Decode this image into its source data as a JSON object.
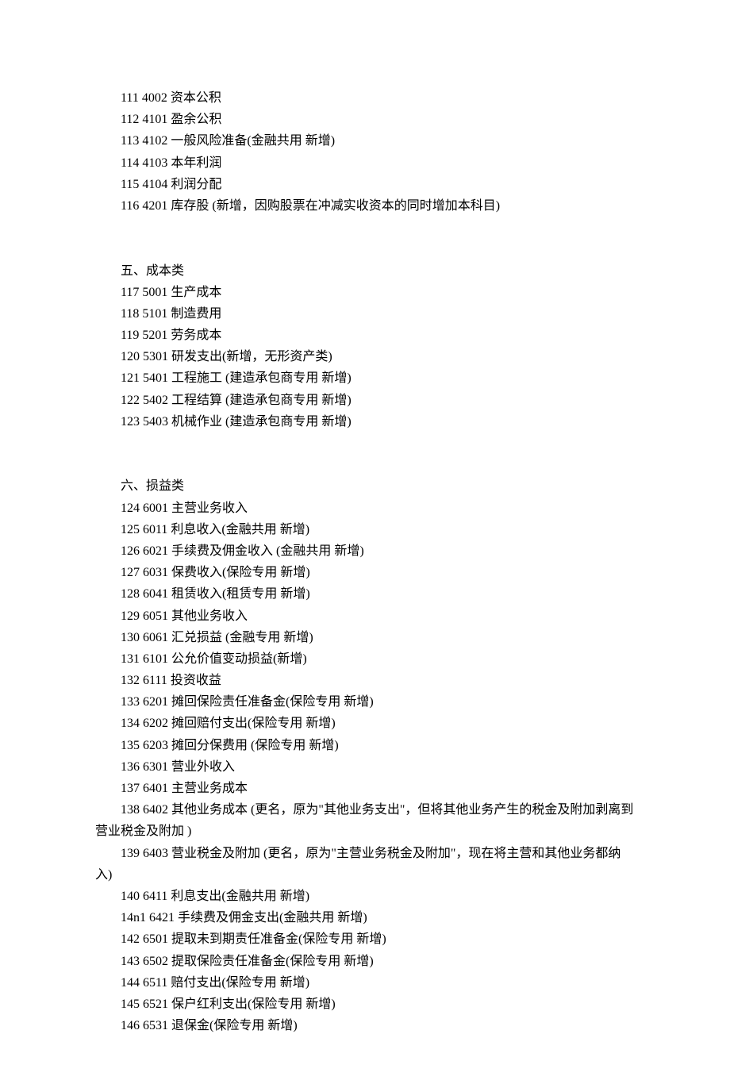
{
  "group1": [
    "111 4002  资本公积",
    "112 4101  盈余公积",
    "113 4102  一般风险准备(金融共用  新增)",
    "114 4103  本年利润",
    "115 4104  利润分配",
    "116 4201  库存股          (新增，因购股票在冲减实收资本的同时增加本科目)"
  ],
  "section5": {
    "heading": "五、成本类",
    "lines": [
      "117 5001  生产成本",
      "118 5101  制造费用",
      "119 5201  劳务成本",
      "120 5301  研发支出(新增，无形资产类)",
      "121 5401  工程施工  (建造承包商专用  新增)",
      "122 5402  工程结算  (建造承包商专用  新增)",
      "123 5403  机械作业  (建造承包商专用  新增)"
    ]
  },
  "section6": {
    "heading": "六、损益类",
    "lines": [
      "124 6001  主营业务收入",
      "125 6011  利息收入(金融共用  新增)",
      "126 6021  手续费及佣金收入  (金融共用  新增)",
      "127 6031  保费收入(保险专用  新增)",
      "128 6041  租赁收入(租赁专用  新增)",
      "129 6051  其他业务收入",
      "130 6061  汇兑损益  (金融专用  新增)",
      "131 6101  公允价值变动损益(新增)",
      "132 6111  投资收益",
      "133 6201  摊回保险责任准备金(保险专用  新增)",
      "134 6202  摊回赔付支出(保险专用  新增)",
      "135 6203  摊回分保费用  (保险专用  新增)",
      "136 6301  营业外收入",
      "137 6401  主营业务成本",
      "138 6402  其他业务成本          (更名，原为\"其他业务支出\"，但将其他业务产生的税金及附加剥离到营业税金及附加  )",
      "139 6403  营业税金及附加       (更名，原为\"主营业务税金及附加\"，现在将主营和其他业务都纳入)",
      "140 6411  利息支出(金融共用  新增)",
      "14n1 6421  手续费及佣金支出(金融共用  新增)",
      "142 6501  提取未到期责任准备金(保险专用  新增)",
      "143 6502  提取保险责任准备金(保险专用  新增)",
      "144 6511  赔付支出(保险专用  新增)",
      "145 6521  保户红利支出(保险专用  新增)",
      "146 6531  退保金(保险专用  新增)"
    ]
  }
}
